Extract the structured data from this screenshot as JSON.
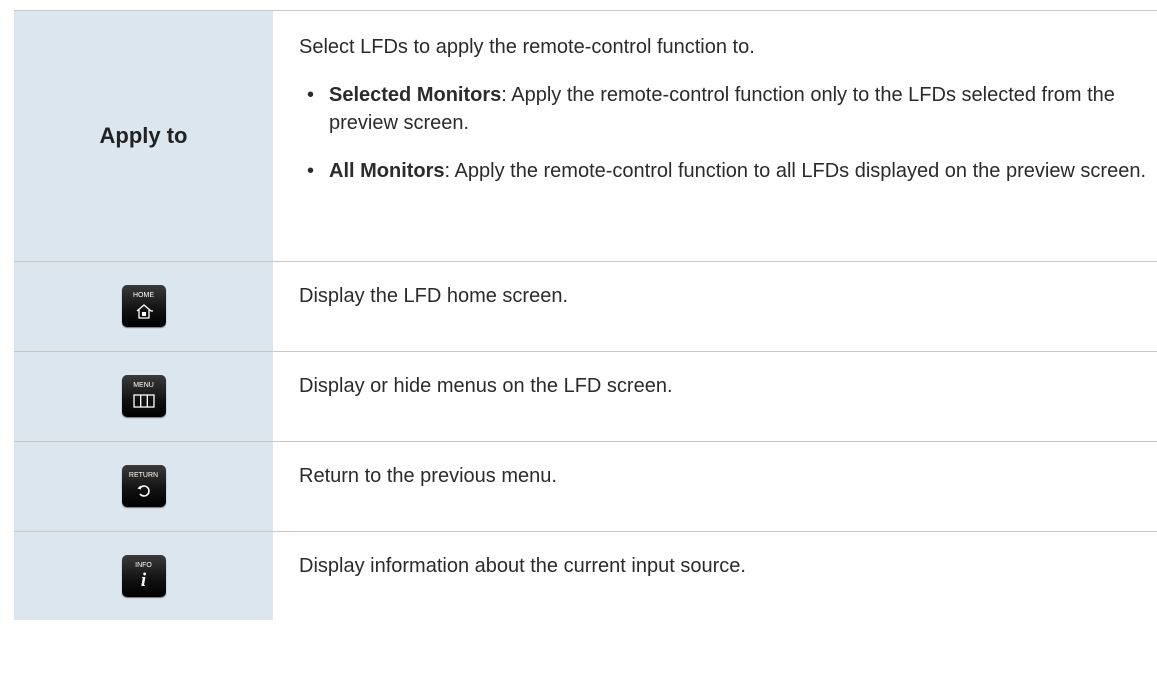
{
  "apply_to": {
    "header": "Apply to",
    "intro": "Select LFDs to apply the remote-control function to.",
    "bullets": [
      {
        "term": "Selected Monitors",
        "desc": ": Apply the remote-control function only to the LFDs selected from the preview screen."
      },
      {
        "term": "All Monitors",
        "desc": ": Apply the remote-control function to all LFDs displayed on the preview screen."
      }
    ],
    "bullet_char": "•"
  },
  "keys": [
    {
      "label": "HOME",
      "icon": "home-icon",
      "desc": "Display the LFD home screen."
    },
    {
      "label": "MENU",
      "icon": "menu-icon",
      "desc": "Display or hide menus on the LFD screen."
    },
    {
      "label": "RETURN",
      "icon": "return-icon",
      "desc": "Return to the previous menu."
    },
    {
      "label": "INFO",
      "icon": "info-icon",
      "icon_text": "i",
      "desc": "Display information about the current input source."
    }
  ],
  "colors": {
    "label_column_bg": "#dce6ee",
    "border": "#c8c8c8",
    "key_bg": "#111111"
  }
}
